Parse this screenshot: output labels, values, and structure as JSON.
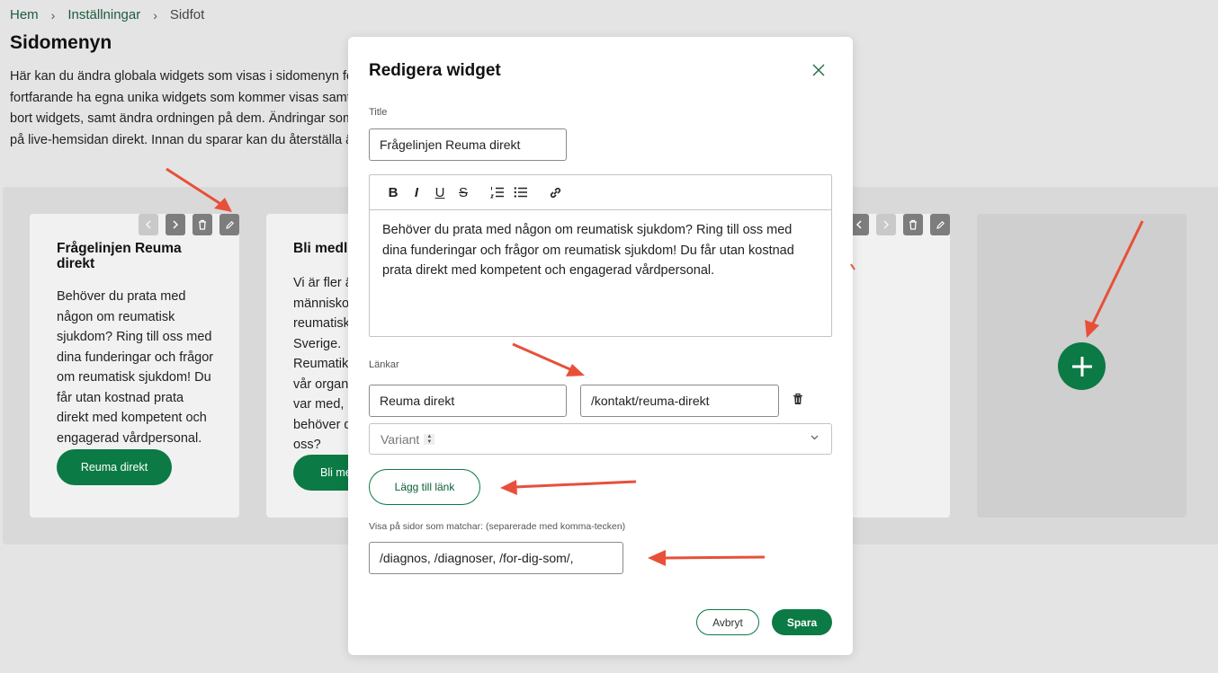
{
  "breadcrumb": {
    "home": "Hem",
    "settings": "Inställningar",
    "current": "Sidfot",
    "separator": "›"
  },
  "page": {
    "title": "Sidomenyn",
    "intro_lines": [
      "Här kan du ändra globala widgets som visas i sidomenyn för",
      "fortfarande ha egna unika widgets som kommer visas samtid",
      "bort widgets, samt ändra ordningen på dem. Ändringar som",
      "på live-hemsidan direkt. Innan du sparar kan du återställa än"
    ]
  },
  "widgets": [
    {
      "title": "Frågelinjen Reuma direkt",
      "body": "Behöver du prata med någon om reumatisk sjukdom? Ring till oss med dina funderingar och frågor om reumatisk sjukdom! Du får utan kostnad prata direkt med kompetent och engagerad vårdpersonal.",
      "button": "Reuma direkt"
    },
    {
      "title": "Bli medl",
      "body_lines": [
        "Vi är fler ä",
        "människo",
        "reumatisk",
        "Sverige.",
        "Reumatik",
        "vår organ",
        "var med, p",
        "behöver d",
        "oss?"
      ],
      "button": "Bli me"
    }
  ],
  "modal": {
    "title": "Redigera widget",
    "title_label": "Title",
    "title_value": "Frågelinjen Reuma direkt",
    "editor_text": "Behöver du prata med någon om reumatisk sjukdom? Ring till oss med dina funderingar och frågor om reumatisk sjukdom! Du får utan kostnad prata direkt med kompetent och engagerad vårdpersonal.",
    "links_label": "Länkar",
    "link_text": "Reuma direkt",
    "link_url": "/kontakt/reuma-direkt",
    "variant_placeholder": "Variant",
    "add_link": "Lägg till länk",
    "pages_label": "Visa på sidor som matchar: (separerade med komma-tecken)",
    "pages_value": "/diagnos, /diagnoser, /for-dig-som/,",
    "cancel": "Avbryt",
    "save": "Spara"
  },
  "colors": {
    "accent": "#0b7a44",
    "annotation": "#e8503a"
  },
  "icons": [
    "chevron-left-icon",
    "chevron-right-icon",
    "trash-icon",
    "pencil-icon",
    "plus-icon",
    "close-icon",
    "bold-icon",
    "italic-icon",
    "underline-icon",
    "strikethrough-icon",
    "ordered-list-icon",
    "bullet-list-icon",
    "link-icon",
    "chevron-down-icon"
  ]
}
